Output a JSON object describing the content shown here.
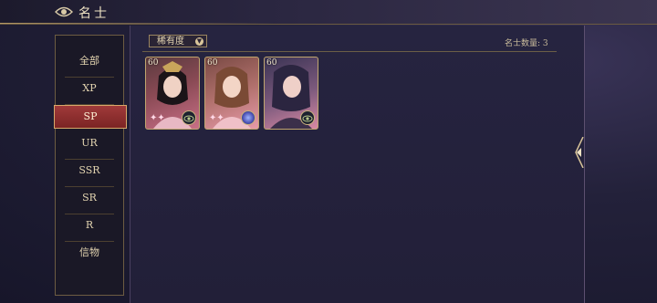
{
  "header": {
    "title": "名士"
  },
  "sidebar": {
    "items": [
      {
        "label": "全部"
      },
      {
        "label": "XP"
      },
      {
        "label": "SP",
        "active": true
      },
      {
        "label": "UR"
      },
      {
        "label": "SSR"
      },
      {
        "label": "SR"
      },
      {
        "label": "R"
      },
      {
        "label": "信物"
      }
    ]
  },
  "filter": {
    "label": "稀有度",
    "icon": "chevron-down-icon"
  },
  "count_text": "名士数量: 3",
  "cards": [
    {
      "level": "60",
      "badge": "eye-icon"
    },
    {
      "level": "60",
      "badge": "orb-icon"
    },
    {
      "level": "60",
      "badge": "eye-icon"
    }
  ],
  "colors": {
    "accent": "#a03a3a",
    "gold": "#c0a56e",
    "panel": "#262440"
  }
}
